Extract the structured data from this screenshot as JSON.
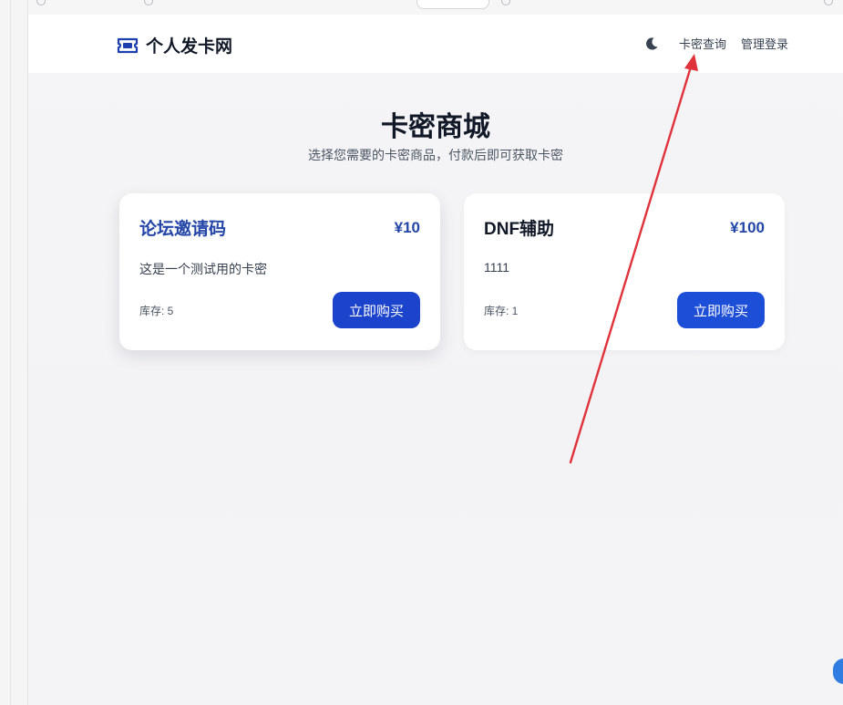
{
  "navbar": {
    "brand_name": "个人发卡网",
    "links": [
      "卡密查询",
      "管理登录"
    ]
  },
  "hero": {
    "title": "卡密商城",
    "subtitle": "选择您需要的卡密商品，付款后即可获取卡密"
  },
  "products": [
    {
      "title": "论坛邀请码",
      "price": "¥10",
      "description": "这是一个测试用的卡密",
      "stock": "库存: 5",
      "button": "立即购买"
    },
    {
      "title": "DNF辅助",
      "price": "¥100",
      "description": "1111",
      "stock": "库存: 1",
      "button": "立即购买"
    }
  ],
  "icons": {
    "brand": "ticket-icon",
    "theme_toggle": "moon-icon",
    "annotation": "red-arrow-annotation"
  },
  "colors": {
    "accent": "#1d4ed8",
    "price": "#2346a8",
    "annotation_arrow": "#e0323a"
  }
}
